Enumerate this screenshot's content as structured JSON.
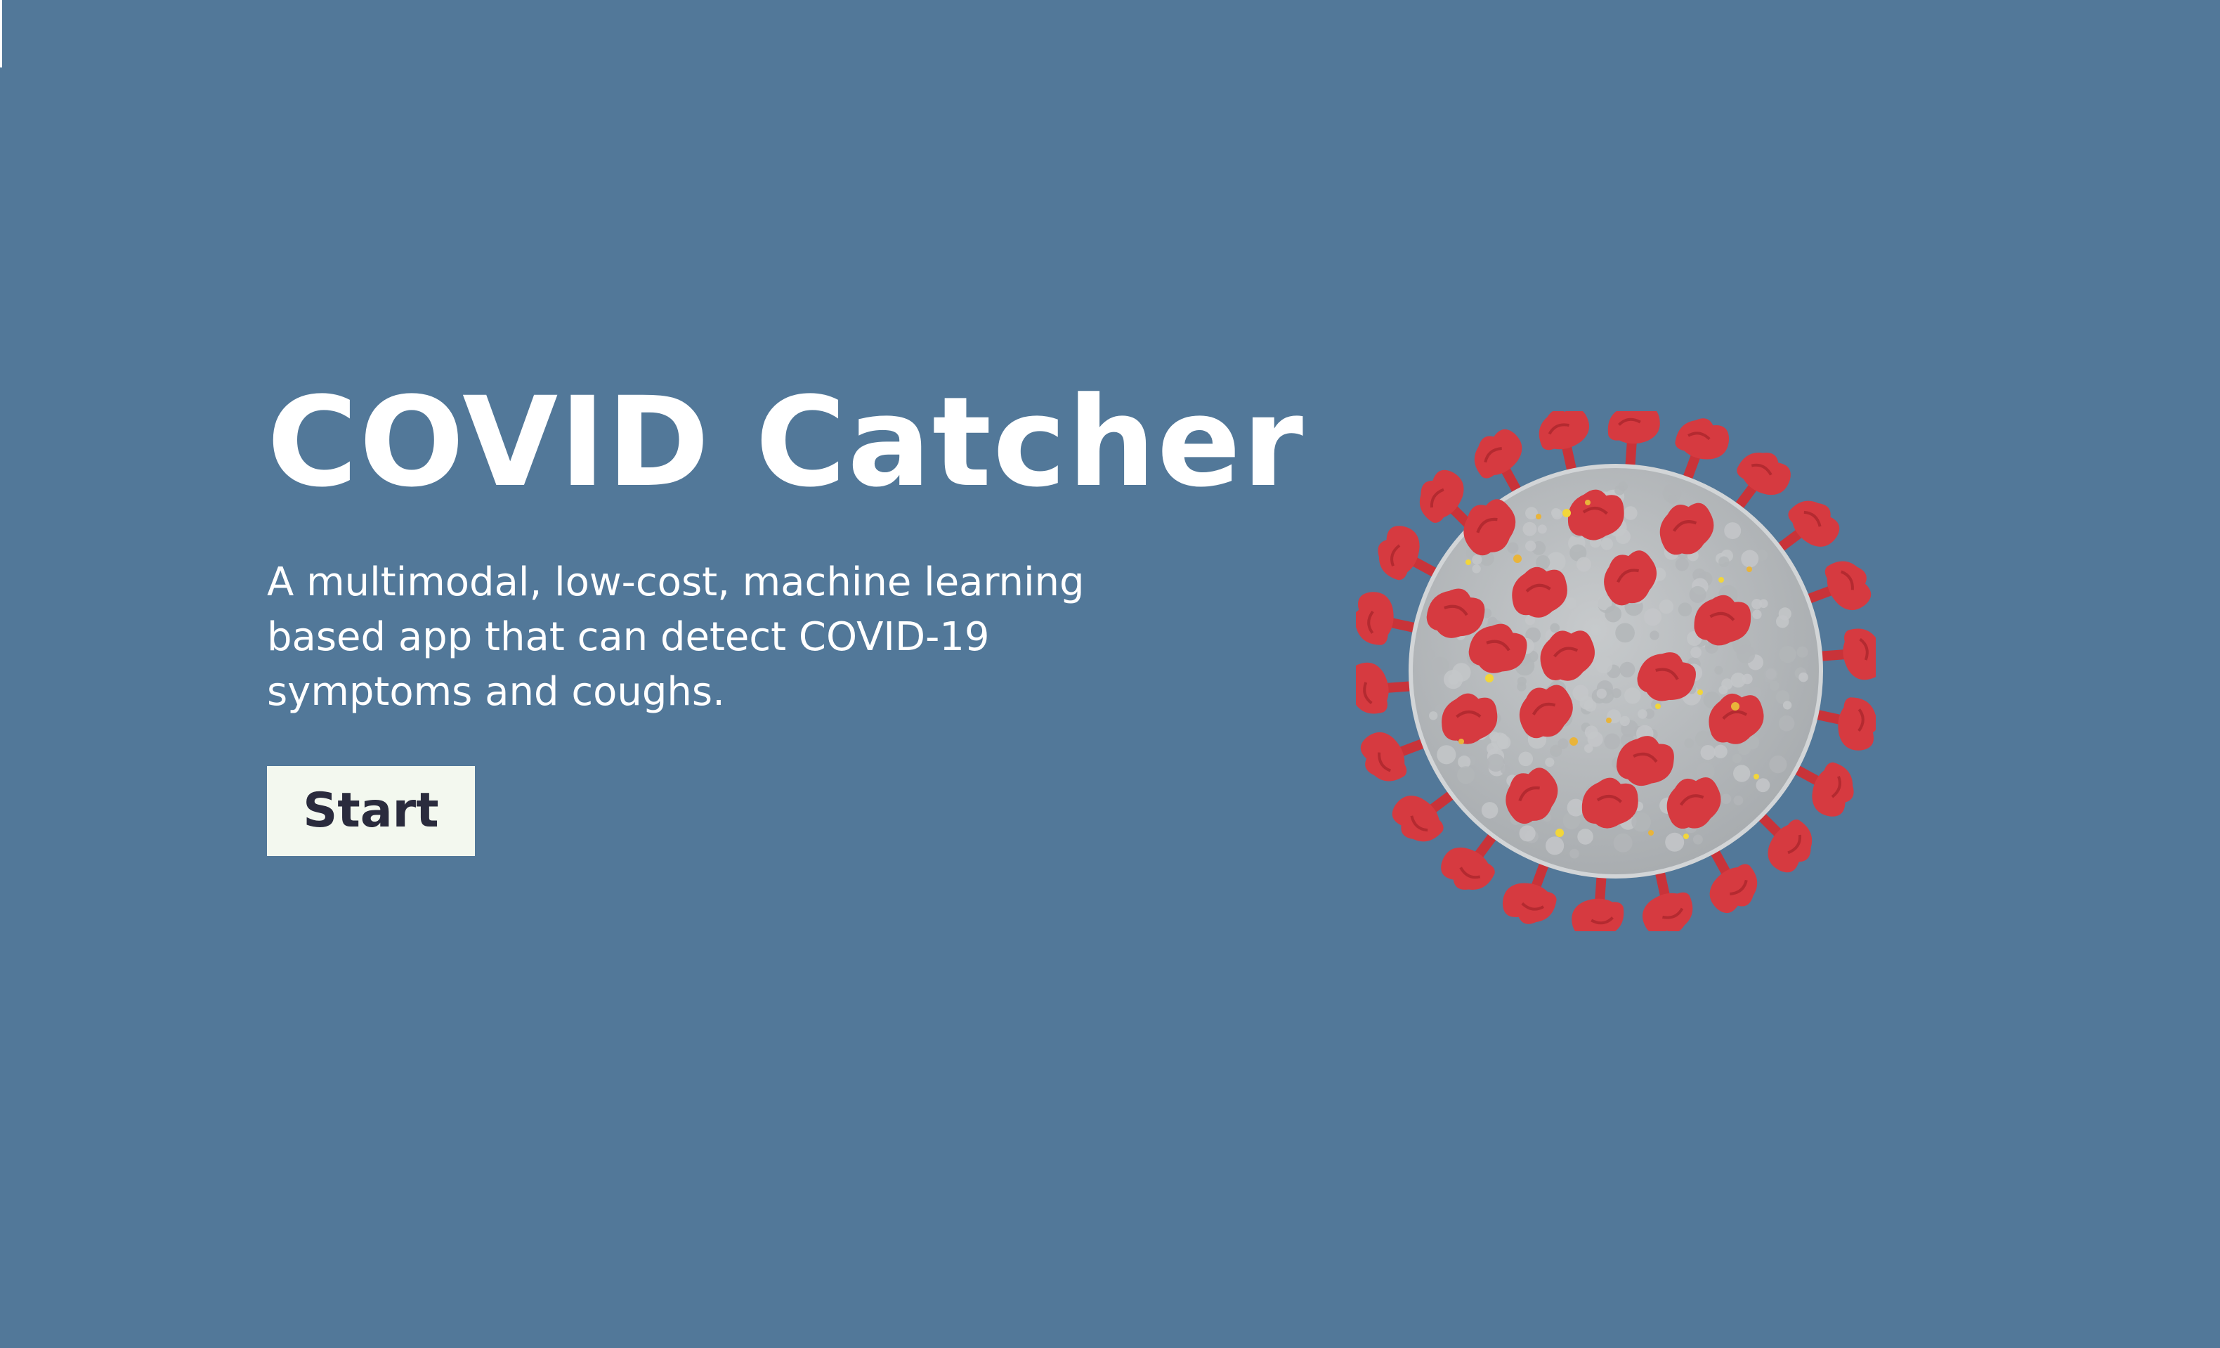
{
  "hero": {
    "title": "COVID Catcher",
    "subtitle": "A multimodal, low-cost, machine learning based app that can detect COVID-19 symptoms and coughs.",
    "start_label": "Start"
  },
  "illustration": {
    "icon": "coronavirus-illustration",
    "body_color": "#b9bcbf",
    "spike_color": "#d23c40"
  },
  "colors": {
    "background": "#527899",
    "button_background": "#f3f8ef",
    "button_text": "#2a2b3d"
  }
}
